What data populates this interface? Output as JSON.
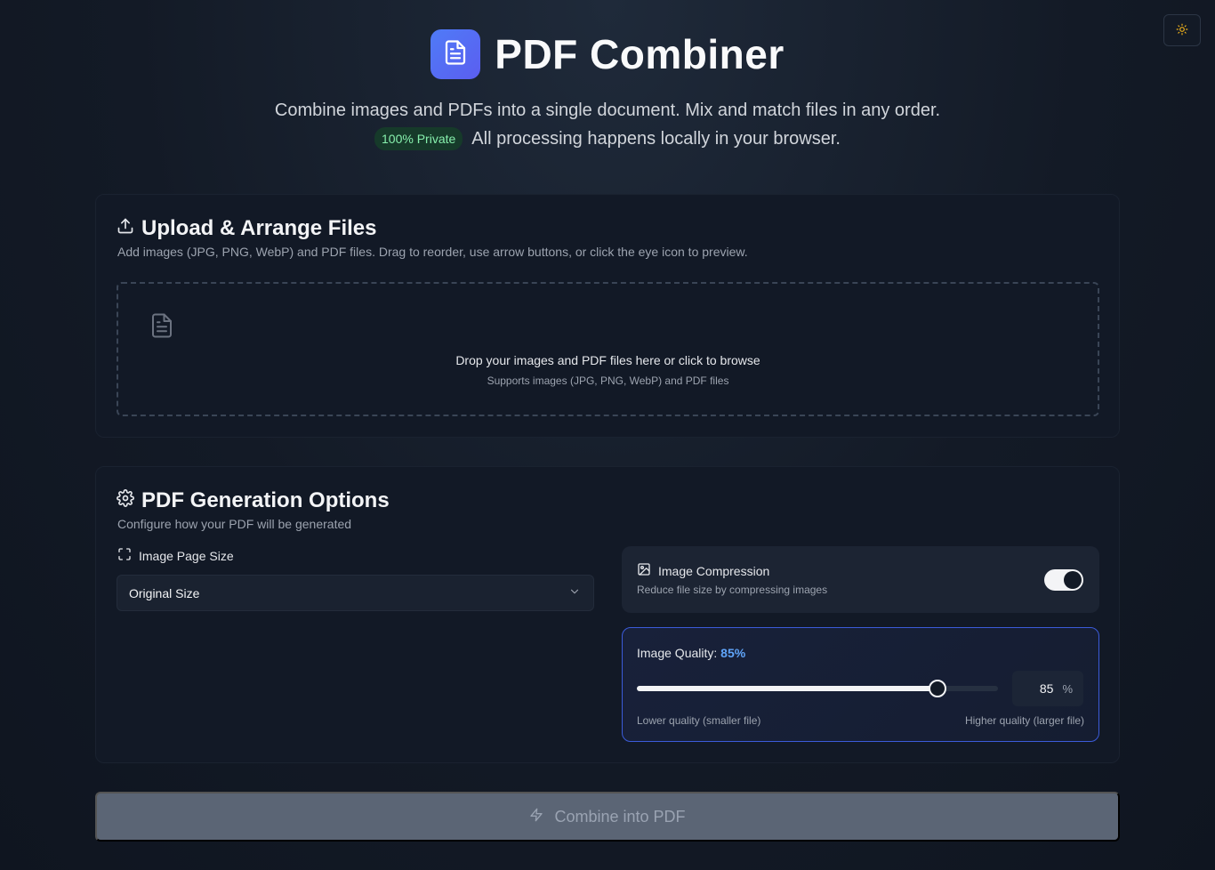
{
  "header": {
    "title": "PDF Combiner",
    "subtitle": "Combine images and PDFs into a single document. Mix and match files in any order.",
    "badge": "100% Private",
    "privacy_note": "All processing happens locally in your browser."
  },
  "upload": {
    "title": "Upload & Arrange Files",
    "description": "Add images (JPG, PNG, WebP) and PDF files. Drag to reorder, use arrow buttons, or click the eye icon to preview.",
    "dropzone_main": "Drop your images and PDF files here or click to browse",
    "dropzone_sub": "Supports images (JPG, PNG, WebP) and PDF files"
  },
  "options": {
    "title": "PDF Generation Options",
    "description": "Configure how your PDF will be generated",
    "page_size_label": "Image Page Size",
    "page_size_value": "Original Size",
    "compression_title": "Image Compression",
    "compression_desc": "Reduce file size by compressing images",
    "compression_enabled": true,
    "quality_label": "Image Quality:",
    "quality_display": "85%",
    "quality_value": 85,
    "quality_input": "85",
    "quality_unit": "%",
    "quality_low_hint": "Lower quality (smaller file)",
    "quality_high_hint": "Higher quality (larger file)"
  },
  "actions": {
    "combine_label": "Combine into PDF"
  },
  "icons": {
    "theme": "sun-icon",
    "logo": "file-text-icon",
    "upload": "upload-icon",
    "dropzone": "file-text-icon",
    "options": "gear-icon",
    "page_size": "maximize-icon",
    "compression": "image-icon",
    "select": "chevron-down-icon",
    "combine": "zap-icon"
  },
  "colors": {
    "accent": "#4f7bf7",
    "quality_accent": "#60a5fa",
    "badge_text": "#86efac"
  }
}
